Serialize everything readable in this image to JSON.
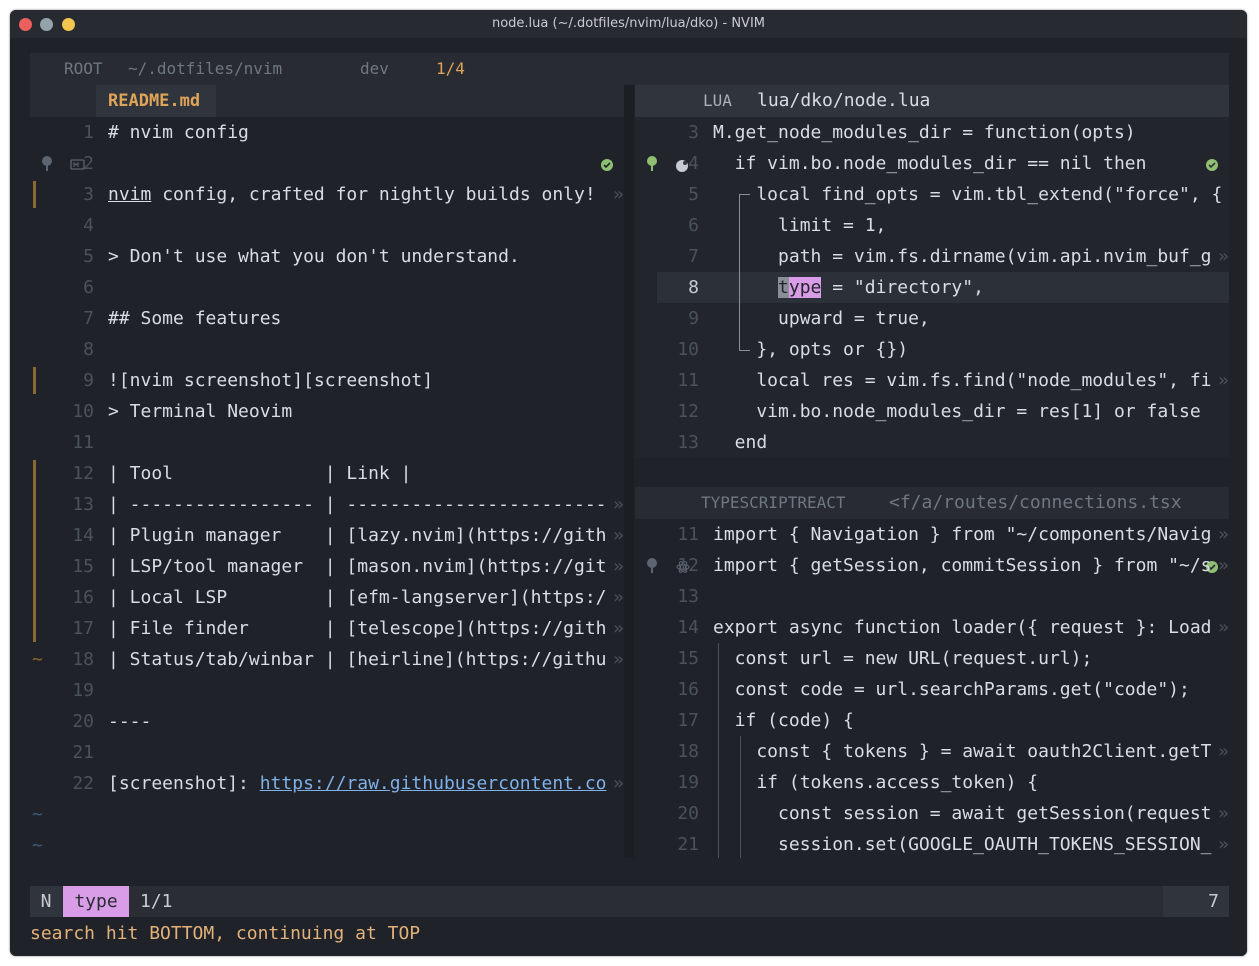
{
  "window": {
    "title": "node.lua (~/.dotfiles/nvim/lua/dko) - NVIM"
  },
  "tabline": {
    "root_label": "ROOT",
    "cwd": "~/.dotfiles/nvim",
    "branch": "dev",
    "tab_count": "1/4"
  },
  "left_pane": {
    "filename": "README.md",
    "lines": [
      {
        "n": "1",
        "text": "# nvim config"
      },
      {
        "n": "2",
        "text": ""
      },
      {
        "n": "3",
        "text": "nvim config, crafted for nightly builds only!"
      },
      {
        "n": "4",
        "text": ""
      },
      {
        "n": "5",
        "text": "> Don't use what you don't understand."
      },
      {
        "n": "6",
        "text": ""
      },
      {
        "n": "7",
        "text": "## Some features"
      },
      {
        "n": "8",
        "text": ""
      },
      {
        "n": "9",
        "text": "![nvim screenshot][screenshot]"
      },
      {
        "n": "10",
        "text": "> Terminal Neovim"
      },
      {
        "n": "11",
        "text": ""
      },
      {
        "n": "12",
        "text": "| Tool              | Link |"
      },
      {
        "n": "13",
        "text": "| ----------------- | ------------------------"
      },
      {
        "n": "14",
        "text": "| Plugin manager    | [lazy.nvim](https://gith"
      },
      {
        "n": "15",
        "text": "| LSP/tool manager  | [mason.nvim](https://git"
      },
      {
        "n": "16",
        "text": "| Local LSP         | [efm-langserver](https:/"
      },
      {
        "n": "17",
        "text": "| File finder       | [telescope](https://gith"
      },
      {
        "n": "18",
        "text": "| Status/tab/winbar | [heirline](https://githu"
      },
      {
        "n": "19",
        "text": ""
      },
      {
        "n": "20",
        "text": "----"
      },
      {
        "n": "21",
        "text": ""
      },
      {
        "n": "22",
        "text": "[screenshot]: https://raw.githubusercontent.co"
      }
    ],
    "overflow_marker": "»",
    "eob": "~"
  },
  "top_right_pane": {
    "filetype": "LUA",
    "filepath": "lua/dko/node.lua",
    "lines": [
      {
        "n": "3",
        "text": "M.get_node_modules_dir = function(opts)"
      },
      {
        "n": "4",
        "text": "  if vim.bo.node_modules_dir == nil then"
      },
      {
        "n": "5",
        "text": "    local find_opts = vim.tbl_extend(\"force\", {"
      },
      {
        "n": "6",
        "text": "      limit = 1,"
      },
      {
        "n": "7",
        "text": "      path = vim.fs.dirname(vim.api.nvim_buf_g"
      },
      {
        "n": "8",
        "text": "      type = \"directory\","
      },
      {
        "n": "9",
        "text": "      upward = true,"
      },
      {
        "n": "10",
        "text": "    }, opts or {})"
      },
      {
        "n": "11",
        "text": "    local res = vim.fs.find(\"node_modules\", fi"
      },
      {
        "n": "12",
        "text": "    vim.bo.node_modules_dir = res[1] or false"
      },
      {
        "n": "13",
        "text": "  end"
      }
    ]
  },
  "bottom_right_pane": {
    "filetype": "TYPESCRIPTREACT",
    "filepath": "<f/a/routes/connections.tsx",
    "lines": [
      {
        "n": "11",
        "text": "import { Navigation } from \"~/components/Navig"
      },
      {
        "n": "12",
        "text": "import { getSession, commitSession } from \"~/s"
      },
      {
        "n": "13",
        "text": ""
      },
      {
        "n": "14",
        "text": "export async function loader({ request }: Load"
      },
      {
        "n": "15",
        "text": "  const url = new URL(request.url);"
      },
      {
        "n": "16",
        "text": "  const code = url.searchParams.get(\"code\");"
      },
      {
        "n": "17",
        "text": "  if (code) {"
      },
      {
        "n": "18",
        "text": "    const { tokens } = await oauth2Client.getT"
      },
      {
        "n": "19",
        "text": "    if (tokens.access_token) {"
      },
      {
        "n": "20",
        "text": "      const session = await getSession(request"
      },
      {
        "n": "21",
        "text": "      session.set(GOOGLE_OAUTH_TOKENS_SESSION_"
      }
    ]
  },
  "statusline": {
    "mode": "N",
    "search_term": "type",
    "search_count": "1/1",
    "right_value": "7"
  },
  "cmdline": {
    "message": "search hit BOTTOM, continuing at TOP"
  },
  "colors": {
    "accent_orange": "#e0a458",
    "search_pink": "#d99ce6",
    "ok_green": "#8fbf72",
    "link_blue": "#7fb0e8"
  }
}
